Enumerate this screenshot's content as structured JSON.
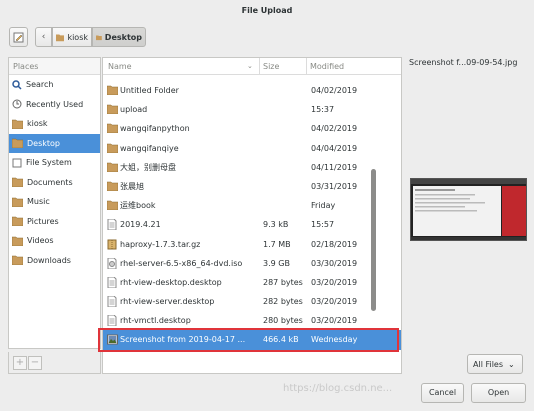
{
  "window": {
    "title": "File Upload"
  },
  "toolbar": {
    "path": [
      {
        "label": "kiosk"
      },
      {
        "label": "Desktop"
      }
    ]
  },
  "places": {
    "header": "Places",
    "items": [
      {
        "label": "Search",
        "icon": "search-icon"
      },
      {
        "label": "Recently Used",
        "icon": "clock-icon"
      },
      {
        "label": "kiosk",
        "icon": "home-folder-icon"
      },
      {
        "label": "Desktop",
        "icon": "desktop-folder-icon",
        "active": true
      },
      {
        "label": "File System",
        "icon": "drive-icon"
      },
      {
        "label": "Documents",
        "icon": "documents-folder-icon"
      },
      {
        "label": "Music",
        "icon": "music-folder-icon"
      },
      {
        "label": "Pictures",
        "icon": "pictures-folder-icon"
      },
      {
        "label": "Videos",
        "icon": "videos-folder-icon"
      },
      {
        "label": "Downloads",
        "icon": "downloads-folder-icon"
      }
    ],
    "add_label": "+",
    "remove_label": "−"
  },
  "files": {
    "columns": {
      "name": "Name",
      "size": "Size",
      "modified": "Modified"
    },
    "rows": [
      {
        "name": "Untitled Folder",
        "size": "",
        "modified": "04/02/2019",
        "icon": "folder-icon"
      },
      {
        "name": "upload",
        "size": "",
        "modified": "15:37",
        "icon": "folder-icon"
      },
      {
        "name": "wangqifanpython",
        "size": "",
        "modified": "04/02/2019",
        "icon": "folder-icon"
      },
      {
        "name": "wangqifanqiye",
        "size": "",
        "modified": "04/04/2019",
        "icon": "folder-icon"
      },
      {
        "name": "大姐，别删母盘",
        "size": "",
        "modified": "04/11/2019",
        "icon": "folder-icon"
      },
      {
        "name": "张晨旭",
        "size": "",
        "modified": "03/31/2019",
        "icon": "folder-icon"
      },
      {
        "name": "运维book",
        "size": "",
        "modified": "Friday",
        "icon": "folder-icon"
      },
      {
        "name": "2019.4.21",
        "size": "9.3 kB",
        "modified": "15:57",
        "icon": "text-file-icon"
      },
      {
        "name": "haproxy-1.7.3.tar.gz",
        "size": "1.7 MB",
        "modified": "02/18/2019",
        "icon": "archive-icon"
      },
      {
        "name": "rhel-server-6.5-x86_64-dvd.iso",
        "size": "3.9 GB",
        "modified": "03/30/2019",
        "icon": "disc-image-icon"
      },
      {
        "name": "rht-view-desktop.desktop",
        "size": "287 bytes",
        "modified": "03/20/2019",
        "icon": "text-file-icon"
      },
      {
        "name": "rht-view-server.desktop",
        "size": "282 bytes",
        "modified": "03/20/2019",
        "icon": "text-file-icon"
      },
      {
        "name": "rht-vmctl.desktop",
        "size": "280 bytes",
        "modified": "03/20/2019",
        "icon": "text-file-icon"
      },
      {
        "name": "Screenshot from 2019-04-17 ...",
        "size": "466.4 kB",
        "modified": "Wednesday",
        "icon": "image-file-icon",
        "selected": true
      }
    ]
  },
  "preview": {
    "filename": "Screenshot f...09-09-54.jpg"
  },
  "filter": {
    "label": "All Files"
  },
  "actions": {
    "cancel": "Cancel",
    "open": "Open"
  },
  "watermark": "https://blog.csdn.ne...",
  "colors": {
    "accent": "#4a90d9",
    "highlight_box": "#e0343a"
  }
}
